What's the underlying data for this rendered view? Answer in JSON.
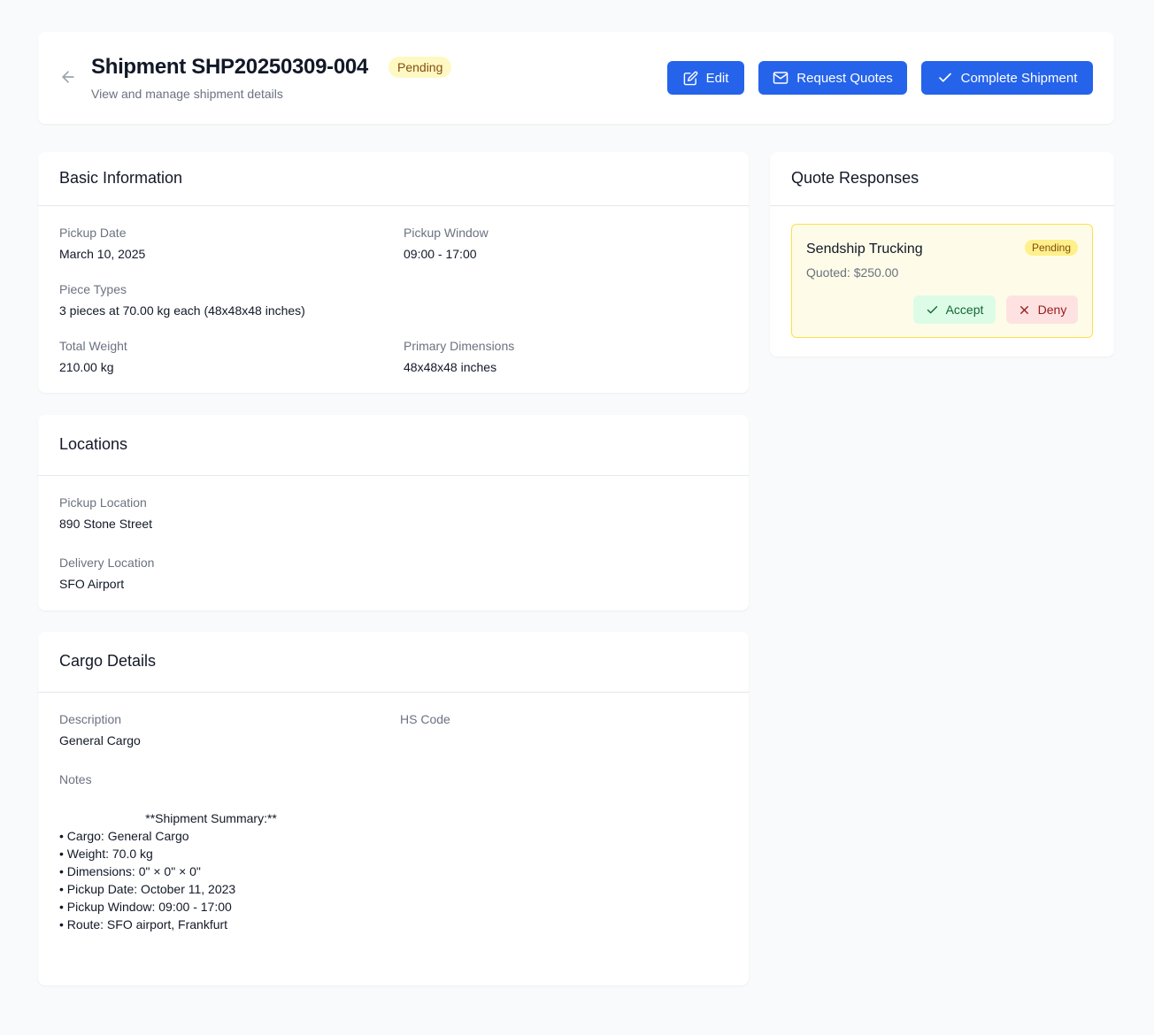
{
  "header": {
    "title": "Shipment SHP20250309-004",
    "status": "Pending",
    "subtitle": "View and manage shipment details",
    "buttons": {
      "edit": "Edit",
      "request_quotes": "Request Quotes",
      "complete": "Complete Shipment"
    }
  },
  "basic_info": {
    "title": "Basic Information",
    "pickup_date_label": "Pickup Date",
    "pickup_date": "March 10, 2025",
    "pickup_window_label": "Pickup Window",
    "pickup_window": "09:00 - 17:00",
    "piece_types_label": "Piece Types",
    "piece_types": "3 pieces at 70.00 kg each (48x48x48 inches)",
    "total_weight_label": "Total Weight",
    "total_weight": "210.00 kg",
    "primary_dimensions_label": "Primary Dimensions",
    "primary_dimensions": "48x48x48 inches"
  },
  "locations": {
    "title": "Locations",
    "pickup_label": "Pickup Location",
    "pickup": "890 Stone Street",
    "delivery_label": "Delivery Location",
    "delivery": "SFO Airport"
  },
  "cargo": {
    "title": "Cargo Details",
    "description_label": "Description",
    "description": "General Cargo",
    "hs_code_label": "HS Code",
    "notes_label": "Notes",
    "notes": "                         **Shipment Summary:**\n• Cargo: General Cargo\n• Weight: 70.0 kg\n• Dimensions: 0\" × 0\" × 0\"\n• Pickup Date: October 11, 2023\n• Pickup Window: 09:00 - 17:00\n• Route: SFO airport, Frankfurt"
  },
  "quotes": {
    "title": "Quote Responses",
    "items": [
      {
        "company": "Sendship Trucking",
        "status": "Pending",
        "price": "Quoted: $250.00",
        "accept_label": "Accept",
        "deny_label": "Deny"
      }
    ]
  },
  "colors": {
    "primary": "#2563eb",
    "pending_bg": "#fef9c3",
    "pending_text": "#854d0e",
    "accept_bg": "#dcfce7",
    "deny_bg": "#fee2e2"
  },
  "icons": [
    "arrow-left-icon",
    "edit-icon",
    "mail-icon",
    "check-icon",
    "x-icon"
  ]
}
